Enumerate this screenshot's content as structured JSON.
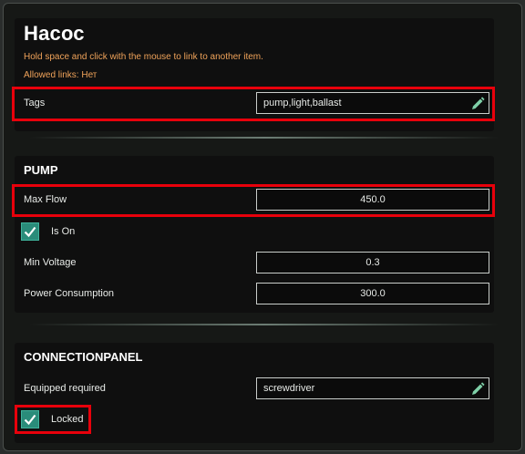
{
  "header": {
    "title": "Насос",
    "hint": "Hold space and click with the mouse to link to another item.",
    "allowed_links": "Allowed links: Нет"
  },
  "tags": {
    "label": "Tags",
    "value": "pump,light,ballast"
  },
  "pump": {
    "heading": "PUMP",
    "max_flow": {
      "label": "Max Flow",
      "value": "450.0"
    },
    "is_on": {
      "label": "Is On",
      "checked": true
    },
    "min_voltage": {
      "label": "Min Voltage",
      "value": "0.3"
    },
    "power_consumption": {
      "label": "Power Consumption",
      "value": "300.0"
    }
  },
  "connection_panel": {
    "heading": "CONNECTIONPANEL",
    "equipped_required": {
      "label": "Equipped required",
      "value": "screwdriver"
    },
    "locked": {
      "label": "Locked",
      "checked": true
    }
  },
  "colors": {
    "highlight": "#e8000b",
    "checkbox": "#2a8c7a",
    "hint_orange": "#f0a35a",
    "edit_icon": "#7fd0a8"
  },
  "icons": [
    "edit-pencil-icon",
    "checkmark-icon"
  ]
}
